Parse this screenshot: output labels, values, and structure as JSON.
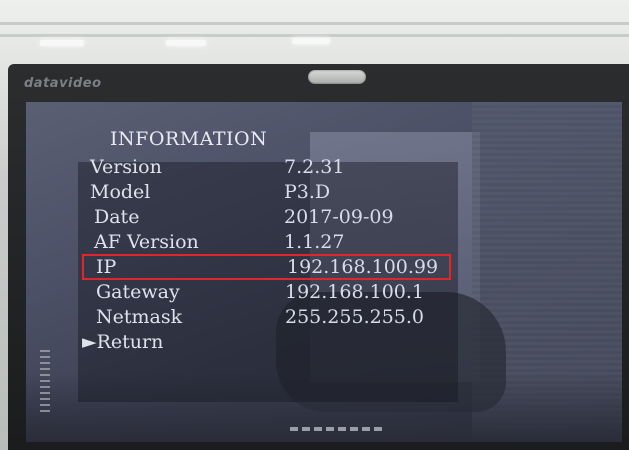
{
  "monitor": {
    "brand": "datavideo"
  },
  "osd": {
    "title": "INFORMATION",
    "rows": [
      {
        "label": "Version",
        "value": "7.2.31"
      },
      {
        "label": "Model",
        "value": "P3.D"
      },
      {
        "label": "Date",
        "value": "2017-09-09"
      },
      {
        "label": "AF Version",
        "value": "1.1.27"
      },
      {
        "label": "IP",
        "value": "192.168.100.99"
      },
      {
        "label": "Gateway",
        "value": "192.168.100.1"
      },
      {
        "label": "Netmask",
        "value": "255.255.255.0"
      }
    ],
    "return_label": "►Return",
    "highlighted_row": "IP",
    "highlight_color": "#e0262a"
  }
}
